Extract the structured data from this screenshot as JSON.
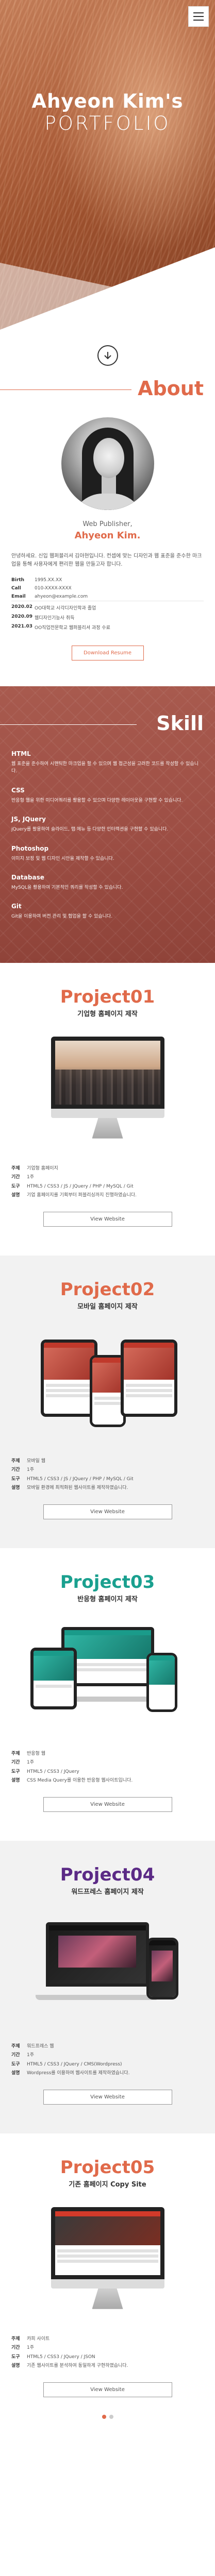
{
  "hero": {
    "title_line1": "Ahyeon Kim's",
    "title_line2": "PORTFOLIO"
  },
  "about": {
    "heading": "About",
    "role": "Web Publisher,",
    "name": "Ahyeon Kim.",
    "intro": "안녕하세요. 신입 웹퍼블리셔 김아현입니다. 컨셉에 맞는 디자인과 웹 표준을 준수한 마크업을 통해 사용자에게 편리한 웹을 만들고자 합니다.",
    "info": [
      {
        "k": "Birth",
        "v": "1995.XX.XX"
      },
      {
        "k": "Call",
        "v": "010-XXXX-XXXX"
      },
      {
        "k": "Email",
        "v": "ahyeon@example.com"
      }
    ],
    "history": [
      {
        "k": "2020.02",
        "v": "OO대학교 시각디자인학과 졸업"
      },
      {
        "k": "2020.09",
        "v": "웹디자인기능사 취득"
      },
      {
        "k": "2021.03",
        "v": "OO직업전문학교 웹퍼블리셔 과정 수료"
      }
    ],
    "download_label": "Download Resume"
  },
  "skill": {
    "heading": "Skill",
    "items": [
      {
        "title": "HTML",
        "desc": "웹 표준을 준수하여 시맨틱한 마크업을 할 수 있으며 웹 접근성을 고려한 코드를 작성할 수 있습니다."
      },
      {
        "title": "CSS",
        "desc": "반응형 웹을 위한 미디어쿼리를 활용할 수 있으며 다양한 레이아웃을 구현할 수 있습니다."
      },
      {
        "title": "JS, JQuery",
        "desc": "jQuery를 활용하여 슬라이드, 탭 메뉴 등 다양한 인터랙션을 구현할 수 있습니다."
      },
      {
        "title": "Photoshop",
        "desc": "이미지 보정 및 웹 디자인 시안을 제작할 수 있습니다."
      },
      {
        "title": "Database",
        "desc": "MySQL을 활용하여 기본적인 쿼리를 작성할 수 있습니다."
      },
      {
        "title": "Git",
        "desc": "Git을 이용하여 버전 관리 및 협업을 할 수 있습니다."
      }
    ]
  },
  "projects": [
    {
      "title": "Project01",
      "subtitle": "기업형 홈페이지 제작",
      "rows": [
        {
          "k": "주제",
          "v": "기업형 홈페이지"
        },
        {
          "k": "기간",
          "v": "1주"
        },
        {
          "k": "도구",
          "v": "HTML5 / CSS3 / JS / JQuery / PHP / MySQL / Git"
        },
        {
          "k": "설명",
          "v": "기업 홈페이지를 기획부터 퍼블리싱까지 진행하였습니다."
        }
      ],
      "button": "View Website",
      "color": "#e06a4a"
    },
    {
      "title": "Project02",
      "subtitle": "모바일 홈페이지 제작",
      "rows": [
        {
          "k": "주제",
          "v": "모바일 웹"
        },
        {
          "k": "기간",
          "v": "1주"
        },
        {
          "k": "도구",
          "v": "HTML5 / CSS3 / JS / JQuery / PHP / MySQL / Git"
        },
        {
          "k": "설명",
          "v": "모바일 환경에 최적화된 웹사이트를 제작하였습니다."
        }
      ],
      "button": "View Website",
      "color": "#e06a4a"
    },
    {
      "title": "Project03",
      "subtitle": "반응형 홈페이지 제작",
      "rows": [
        {
          "k": "주제",
          "v": "반응형 웹"
        },
        {
          "k": "기간",
          "v": "1주"
        },
        {
          "k": "도구",
          "v": "HTML5 / CSS3 / JQuery"
        },
        {
          "k": "설명",
          "v": "CSS Media Query를 이용한 반응형 웹사이트입니다."
        }
      ],
      "button": "View Website",
      "color": "#1aa08f"
    },
    {
      "title": "Project04",
      "subtitle": "워드프레스 홈페이지 제작",
      "rows": [
        {
          "k": "주제",
          "v": "워드프레스 웹"
        },
        {
          "k": "기간",
          "v": "1주"
        },
        {
          "k": "도구",
          "v": "HTML5 / CSS3 / JQuery / CMS(Wordpress)"
        },
        {
          "k": "설명",
          "v": "Wordpress를 이용하여 웹사이트를 제작하였습니다."
        }
      ],
      "button": "View Website",
      "color": "#5b2a86"
    },
    {
      "title": "Project05",
      "subtitle": "기존 홈페이지 Copy Site",
      "rows": [
        {
          "k": "주제",
          "v": "카피 사이트"
        },
        {
          "k": "기간",
          "v": "1주"
        },
        {
          "k": "도구",
          "v": "HTML5 / CSS3 / JQuery / JSON"
        },
        {
          "k": "설명",
          "v": "기존 웹사이트를 분석하여 동일하게 구현하였습니다."
        }
      ],
      "button": "View Website",
      "color": "#e06a4a"
    }
  ],
  "colors": {
    "accent": "#e06a4a",
    "skill_bg": "#9e4f45"
  }
}
